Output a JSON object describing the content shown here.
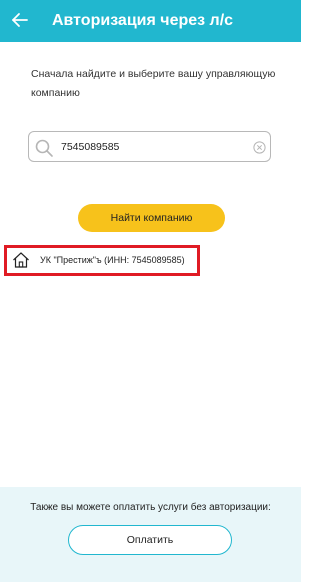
{
  "header": {
    "back_icon": "arrow-left-icon",
    "title": "Авторизация через л/с"
  },
  "instruction": "Сначала найдите и выберите вашу управляющую компанию",
  "search": {
    "icon": "search-icon",
    "value": "7545089585",
    "clear_icon": "clear-icon"
  },
  "find_button_label": "Найти компанию",
  "results": [
    {
      "icon": "home-icon",
      "label": "УК \"Престиж\"ъ (ИНН: 7545089585)",
      "highlighted": true
    }
  ],
  "footer": {
    "text": "Также вы можете оплатить услуги без авторизации:",
    "pay_button_label": "Оплатить"
  },
  "colors": {
    "accent": "#21b7cf",
    "button_yellow": "#f7c21b",
    "highlight": "#e01b24",
    "footer_bg": "#e8f6f9"
  }
}
